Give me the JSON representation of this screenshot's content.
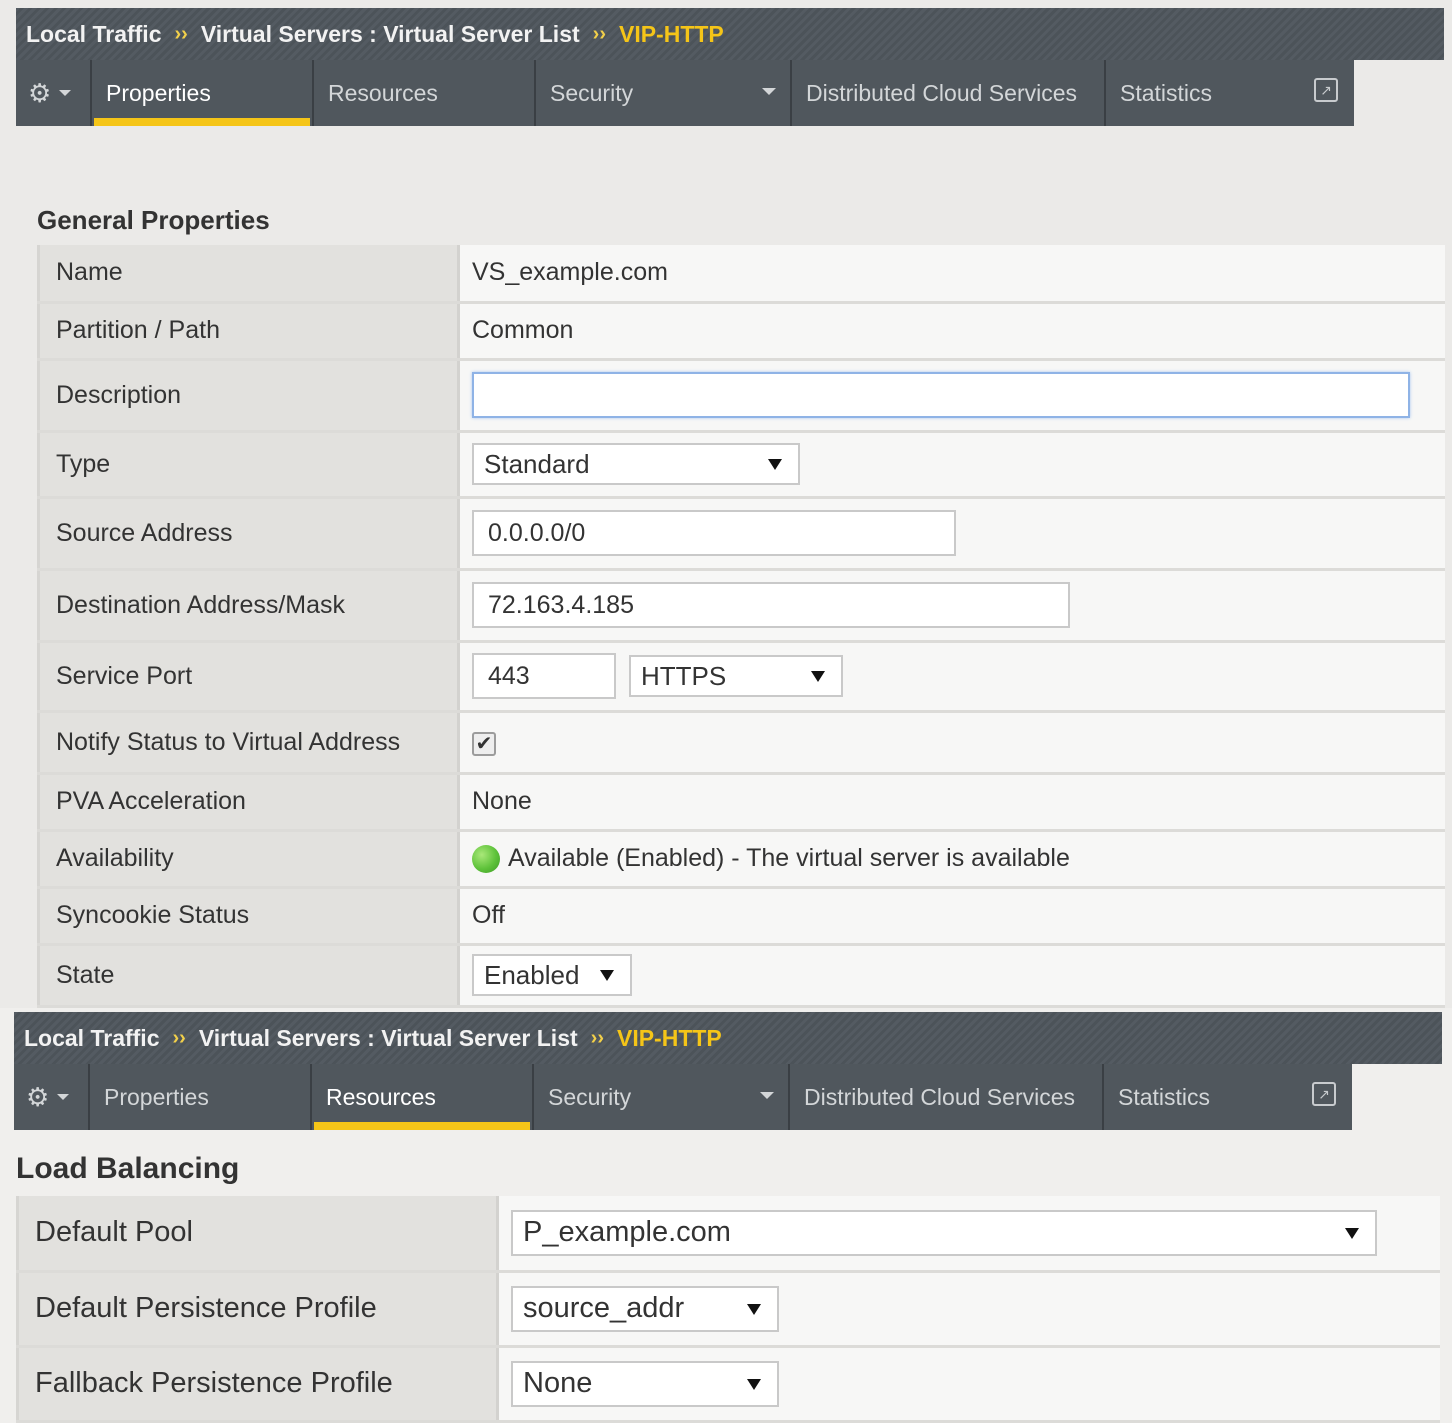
{
  "breadcrumb": {
    "section": "Local Traffic",
    "list": "Virtual Servers : Virtual Server List",
    "separator": "››",
    "current": "VIP-HTTP"
  },
  "tabs": [
    {
      "label": "Properties"
    },
    {
      "label": "Resources"
    },
    {
      "label": "Security"
    },
    {
      "label": "Distributed Cloud Services"
    },
    {
      "label": "Statistics"
    }
  ],
  "icons": {
    "gear": "gear-icon",
    "external": "external-link-icon",
    "check": "checkmark-icon",
    "status": "green-status-icon"
  },
  "colors": {
    "accent": "#f5c518",
    "header": "#50575d",
    "status_ok": "#5ec23a"
  },
  "general": {
    "title": "General Properties",
    "rows": {
      "name": {
        "label": "Name",
        "value": "VS_example.com"
      },
      "partition": {
        "label": "Partition / Path",
        "value": "Common"
      },
      "description": {
        "label": "Description",
        "value": ""
      },
      "type": {
        "label": "Type",
        "value": "Standard"
      },
      "source": {
        "label": "Source Address",
        "value": "0.0.0.0/0"
      },
      "destination": {
        "label": "Destination Address/Mask",
        "value": "72.163.4.185"
      },
      "service_port": {
        "label": "Service Port",
        "port": "443",
        "protocol": "HTTPS"
      },
      "notify": {
        "label": "Notify Status to Virtual Address",
        "checked": true,
        "check_glyph": "✔"
      },
      "pva": {
        "label": "PVA Acceleration",
        "value": "None"
      },
      "availability": {
        "label": "Availability",
        "value": "Available (Enabled) - The virtual server is available"
      },
      "syncookie": {
        "label": "Syncookie Status",
        "value": "Off"
      },
      "state": {
        "label": "State",
        "value": "Enabled"
      }
    }
  },
  "load_balancing": {
    "title": "Load Balancing",
    "rows": {
      "default_pool": {
        "label": "Default Pool",
        "value": "P_example.com"
      },
      "default_persistence": {
        "label": "Default Persistence Profile",
        "value": "source_addr"
      },
      "fallback_persistence": {
        "label": "Fallback Persistence Profile",
        "value": "None"
      }
    }
  }
}
